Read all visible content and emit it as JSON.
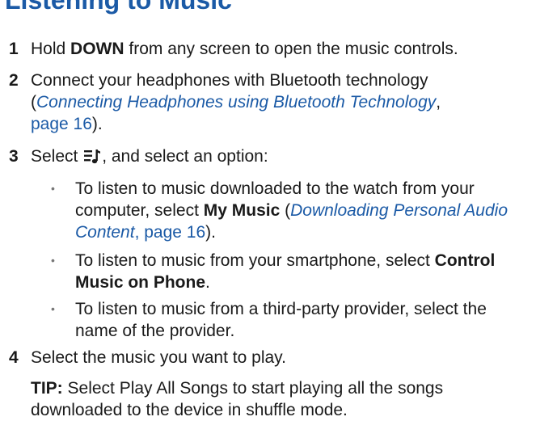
{
  "heading": "Listening to Music",
  "steps": [
    {
      "num": "1",
      "pre": "Hold ",
      "bold": "DOWN",
      "post": " from any screen to open the music controls."
    },
    {
      "num": "2",
      "line1": "Connect your headphones with Bluetooth technology",
      "paren_open": "(",
      "link_title": "Connecting Headphones using Bluetooth Technology",
      "link_sep": ",",
      "link_page": "page 16",
      "paren_close": ")."
    },
    {
      "num": "3",
      "pre": "Select ",
      "icon": "music-list-icon",
      "post": ", and select an option:",
      "options": [
        {
          "line1": "To listen to music downloaded to the watch from your",
          "pre": "computer, select ",
          "bold": "My Music",
          "mid": " (",
          "link_title_a": "Downloading Personal Audio",
          "link_title_b": "Content",
          "link_sep": ", ",
          "link_page": "page 16",
          "post": ")."
        },
        {
          "pre": "To listen to music from your smartphone, select ",
          "bold_a": "Control",
          "bold_b": "Music on Phone",
          "post": "."
        },
        {
          "line1": "To listen to music from a third-party provider, select the",
          "line2": "name of the provider."
        }
      ]
    },
    {
      "num": "4",
      "text": "Select the music you want to play."
    }
  ],
  "tip": {
    "label": "TIP:",
    "line1": " Select Play All Songs to start playing all the songs",
    "line2": "downloaded to the device in shuffle mode."
  }
}
